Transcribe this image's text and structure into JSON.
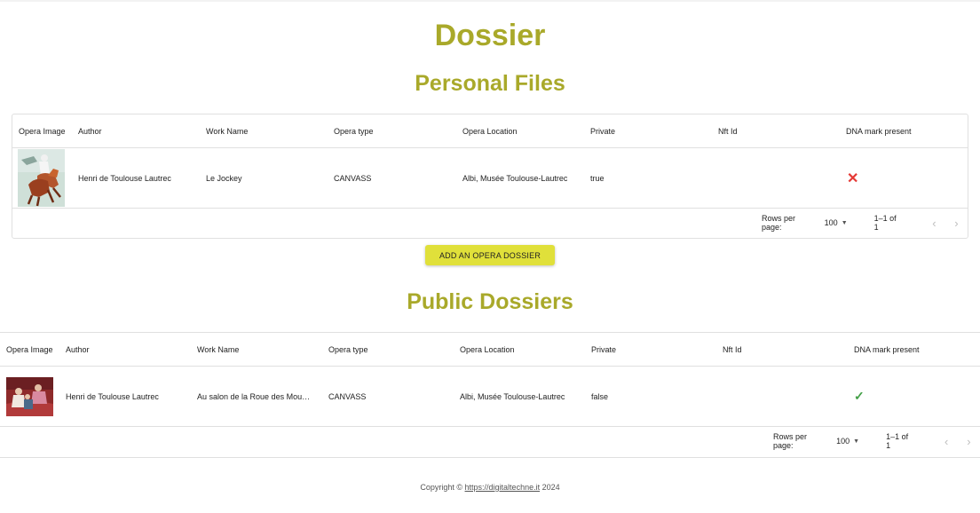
{
  "page": {
    "title": "Dossier"
  },
  "personal": {
    "heading": "Personal Files",
    "columns": [
      "Opera Image",
      "Author",
      "Work Name",
      "Opera type",
      "Opera Location",
      "Private",
      "Nft Id",
      "DNA mark present"
    ],
    "row": {
      "image_icon": "jockey-painting-thumbnail",
      "author": "Henri de Toulouse Lautrec",
      "work_name": "Le Jockey",
      "opera_type": "CANVASS",
      "location": "Albi, Musée Toulouse-Lautrec",
      "private": "true",
      "nft_id": "",
      "dna_icon": "cross-icon"
    },
    "pagination": {
      "rows_label": "Rows per page:",
      "rows_value": "100",
      "range": "1–1 of 1"
    }
  },
  "add_button_label": "ADD AN OPERA DOSSIER",
  "public": {
    "heading": "Public Dossiers",
    "columns": [
      "Opera Image",
      "Author",
      "Work Name",
      "Opera type",
      "Opera Location",
      "Private",
      "Nft Id",
      "DNA mark present"
    ],
    "row": {
      "image_icon": "salon-painting-thumbnail",
      "author": "Henri de Toulouse Lautrec",
      "work_name": "Au salon de la Roue des Mou…",
      "opera_type": "CANVASS",
      "location": "Albi, Musée Toulouse-Lautrec",
      "private": "false",
      "nft_id": "",
      "dna_icon": "check-icon"
    },
    "pagination": {
      "rows_label": "Rows per page:",
      "rows_value": "100",
      "range": "1–1 of 1"
    }
  },
  "footer": {
    "prefix": "Copyright ©",
    "link": "https://digitaltechne.it",
    "year": "2024"
  },
  "colors": {
    "heading": "#a9a92a",
    "button": "#e0e03a",
    "cross": "#e53935",
    "check": "#43a047"
  }
}
